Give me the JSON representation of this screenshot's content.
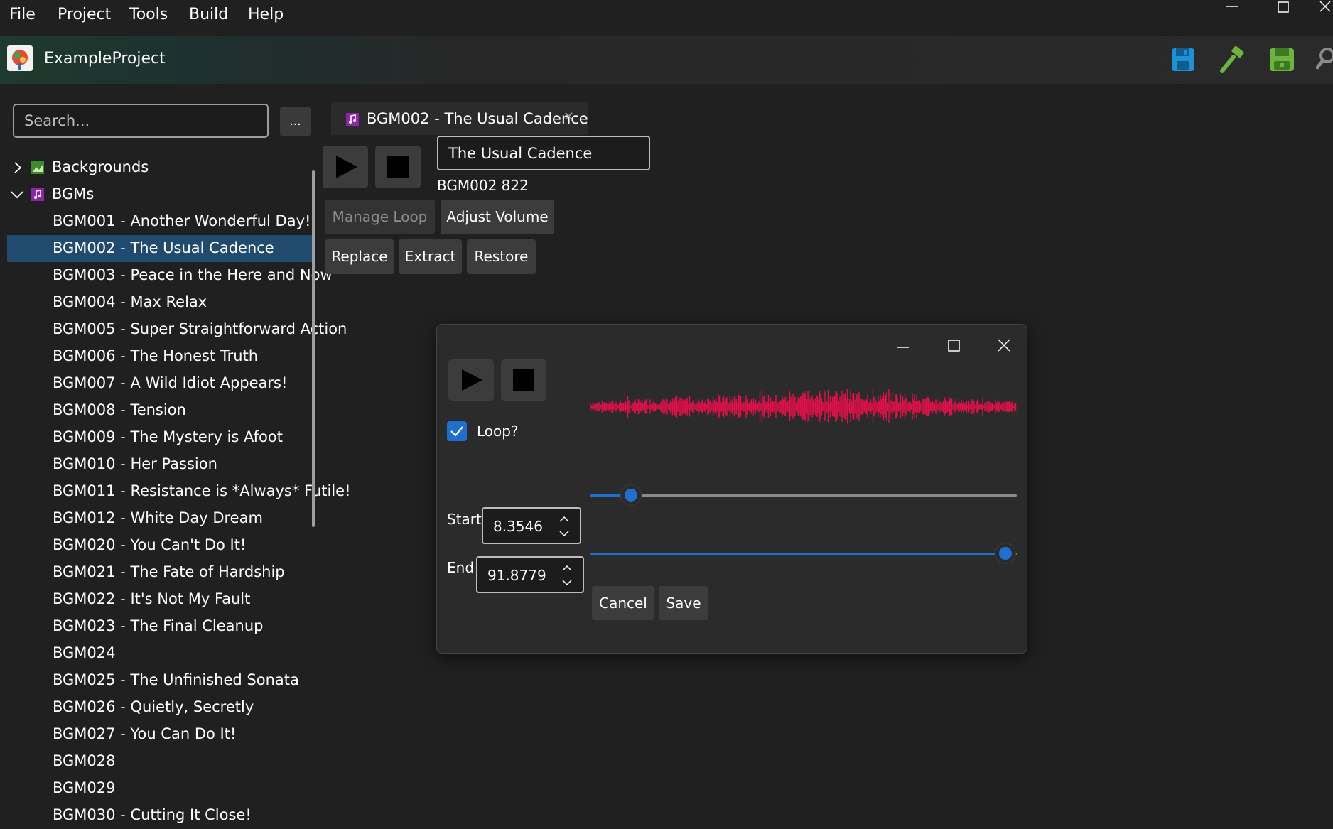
{
  "menu": [
    "File",
    "Project",
    "Tools",
    "Build",
    "Help"
  ],
  "window_controls": {
    "minimize": "—",
    "maximize": "☐",
    "close": "✕"
  },
  "header": {
    "project_name": "ExampleProject",
    "toolbar_icons": [
      "save-icon",
      "build-hammer-icon",
      "save-all-icon",
      "search-icon"
    ],
    "colors": {
      "save": "#1e90d4",
      "build": "#6db33f",
      "save_all": "#6db33f"
    }
  },
  "sidebar": {
    "search_placeholder": "Search...",
    "more_button": "...",
    "tree": [
      {
        "label": "Backgrounds",
        "expanded": false,
        "icon": "image-icon"
      },
      {
        "label": "BGMs",
        "expanded": true,
        "icon": "music-icon"
      }
    ],
    "bgm_items": [
      "BGM001 - Another Wonderful Day!",
      "BGM002 - The Usual Cadence",
      "BGM003 - Peace in the Here and Now",
      "BGM004 - Max Relax",
      "BGM005 - Super Straightforward Action",
      "BGM006 - The Honest Truth",
      "BGM007 - A Wild Idiot Appears!",
      "BGM008 - Tension",
      "BGM009 - The Mystery is Afoot",
      "BGM010 - Her Passion",
      "BGM011 - Resistance is *Always* Futile!",
      "BGM012 - White Day Dream",
      "BGM020 - You Can't Do It!",
      "BGM021 - The Fate of Hardship",
      "BGM022 - It's Not My Fault",
      "BGM023 - The Final Cleanup",
      "BGM024",
      "BGM025 - The Unfinished Sonata",
      "BGM026 - Quietly, Secretly",
      "BGM027 - You Can Do It!",
      "BGM028",
      "BGM029",
      "BGM030 - Cutting It Close!"
    ],
    "selected_index": 1
  },
  "editor": {
    "tab_label": "BGM002 - The Usual Cadence",
    "tab_close": "✕",
    "title_value": "The Usual Cadence",
    "meta": "BGM002  822",
    "buttons": {
      "manage_loop": "Manage Loop",
      "adjust_volume": "Adjust Volume",
      "replace": "Replace",
      "extract": "Extract",
      "restore": "Restore"
    }
  },
  "loop_dialog": {
    "loop_label": "Loop?",
    "loop_checked": true,
    "start_label": "Start",
    "start_value": "8.3546",
    "end_label": "End",
    "end_value": "91.8779",
    "start_fraction": 0.091,
    "end_fraction": 1.0,
    "cancel": "Cancel",
    "save": "Save",
    "waveform_color": "#e0104a",
    "accent": "#1f6fd1"
  }
}
